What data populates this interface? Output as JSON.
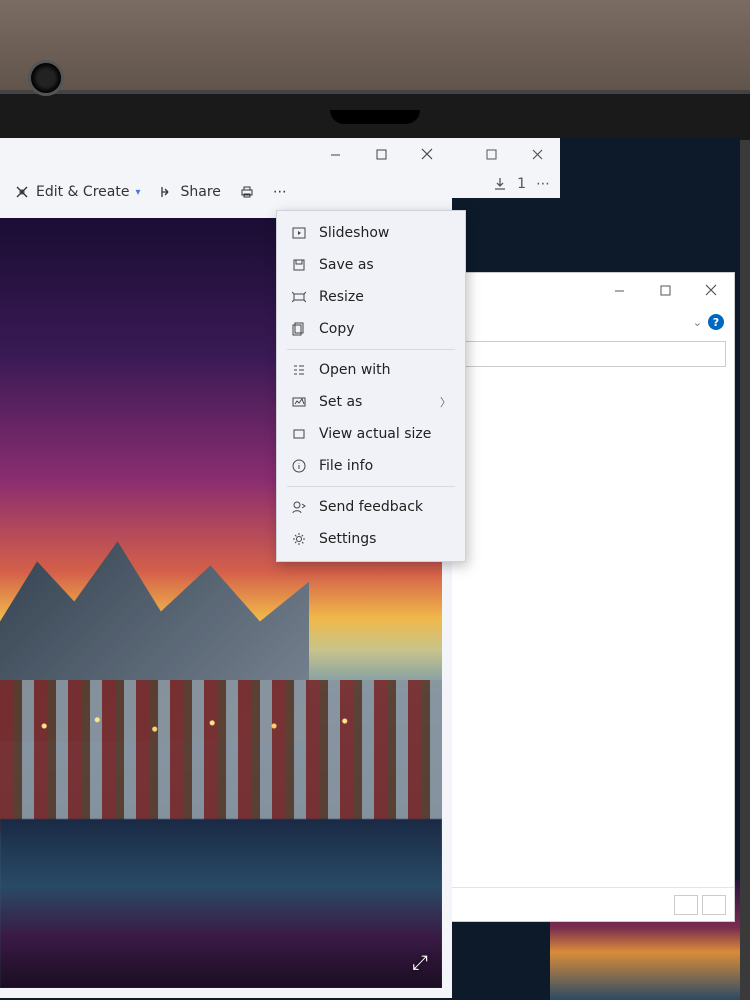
{
  "photos_window": {
    "toolbar": {
      "edit_create": "Edit & Create",
      "share": "Share"
    },
    "titlebar": {
      "minimize": "–",
      "maximize": "□",
      "close": "×"
    }
  },
  "context_menu": {
    "items": [
      {
        "icon": "slideshow-icon",
        "label": "Slideshow"
      },
      {
        "icon": "save-icon",
        "label": "Save as"
      },
      {
        "icon": "resize-icon",
        "label": "Resize"
      },
      {
        "icon": "copy-icon",
        "label": "Copy"
      }
    ],
    "items2": [
      {
        "icon": "openwith-icon",
        "label": "Open with"
      },
      {
        "icon": "setas-icon",
        "label": "Set as",
        "submenu": true
      },
      {
        "icon": "actualsize-icon",
        "label": "View actual size"
      },
      {
        "icon": "info-icon",
        "label": "File info"
      }
    ],
    "items3": [
      {
        "icon": "feedback-icon",
        "label": "Send feedback"
      },
      {
        "icon": "settings-icon",
        "label": "Settings"
      }
    ]
  },
  "bg_window": {
    "toolbar_text": "1",
    "more": "⋯"
  },
  "explorer_window": {
    "titlebar": {
      "minimize": "–",
      "maximize": "□",
      "close": "×"
    },
    "help": "?"
  }
}
